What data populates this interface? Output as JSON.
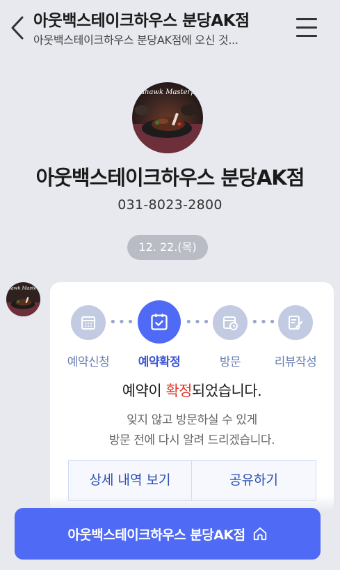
{
  "header": {
    "title": "아웃백스테이크하우스 분당AK점",
    "subtitle": "아웃백스테이크하우스 분당AK점에 오신 것...",
    "back_icon": "chevron-left-icon",
    "menu_icon": "hamburger-menu-icon"
  },
  "profile": {
    "name": "아웃백스테이크하우스 분당AK점",
    "phone": "031-8023-2800",
    "avatar_text": "Tomahawk Masterpiece"
  },
  "date": "12. 22.(목)",
  "card": {
    "steps": [
      {
        "label": "예약신청",
        "icon": "calendar-icon",
        "active": false
      },
      {
        "label": "예약확정",
        "icon": "calendar-check-icon",
        "active": true
      },
      {
        "label": "방문",
        "icon": "calendar-clock-icon",
        "active": false
      },
      {
        "label": "리뷰작성",
        "icon": "edit-icon",
        "active": false
      }
    ],
    "status_prefix": "예약이 ",
    "status_highlight": "확정",
    "status_suffix": "되었습니다.",
    "info_line1": "잊지 않고 방문하실 수 있게",
    "info_line2": "방문 전에 다시 알려 드리겠습니다.",
    "detail_button": "상세 내역 보기",
    "share_button": "공유하기"
  },
  "cta": {
    "label": "아웃백스테이크하우스 분당AK점",
    "icon": "home-icon"
  },
  "colors": {
    "accent": "#4f6af5",
    "highlight": "#e0352b",
    "inactive_step": "#c2cbe2",
    "background": "#e7e9ee"
  }
}
